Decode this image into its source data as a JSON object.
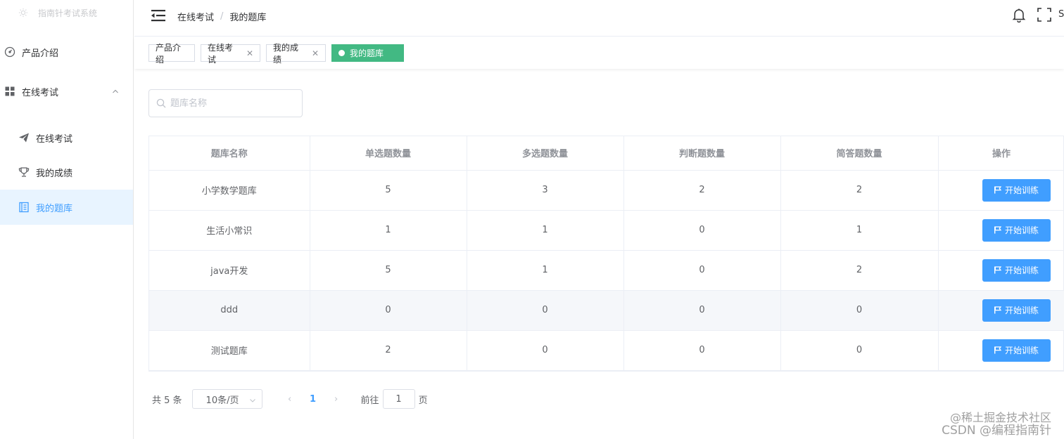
{
  "sidebar": {
    "logo_text": "指南针考试系统",
    "items": [
      {
        "label": "产品介绍",
        "icon": "speedometer-icon"
      },
      {
        "label": "在线考试",
        "icon": "grid-icon"
      }
    ],
    "submenu": [
      {
        "label": "在线考试",
        "icon": "send-icon"
      },
      {
        "label": "我的成绩",
        "icon": "trophy-icon"
      },
      {
        "label": "我的题库",
        "icon": "notebook-icon",
        "active": true
      }
    ]
  },
  "header": {
    "breadcrumb": [
      "在线考试",
      "我的题库"
    ],
    "user_initial": "S"
  },
  "tags": [
    {
      "label": "产品介绍",
      "closable": false
    },
    {
      "label": "在线考试",
      "closable": true
    },
    {
      "label": "我的成绩",
      "closable": true
    },
    {
      "label": "我的题库",
      "active": true
    }
  ],
  "search": {
    "placeholder": "题库名称",
    "value": ""
  },
  "table": {
    "columns": [
      "题库名称",
      "单选题数量",
      "多选题数量",
      "判断题数量",
      "简答题数量",
      "操作"
    ],
    "rows": [
      {
        "name": "小学数学题库",
        "single": "5",
        "multi": "3",
        "judge": "2",
        "short": "2"
      },
      {
        "name": "生活小常识",
        "single": "1",
        "multi": "1",
        "judge": "0",
        "short": "1"
      },
      {
        "name": "java开发",
        "single": "5",
        "multi": "1",
        "judge": "0",
        "short": "2"
      },
      {
        "name": "ddd",
        "single": "0",
        "multi": "0",
        "judge": "0",
        "short": "0"
      },
      {
        "name": "测试题库",
        "single": "2",
        "multi": "0",
        "judge": "0",
        "short": "0"
      }
    ],
    "action_label": "开始训练"
  },
  "pagination": {
    "total_text": "共 5 条",
    "page_size": "10条/页",
    "current_page": "1",
    "goto_label": "前往",
    "goto_value": "1",
    "page_suffix": "页"
  },
  "watermark": {
    "line1": "@稀土掘金技术社区",
    "line2": "CSDN @编程指南针"
  },
  "colors": {
    "primary": "#409eff",
    "tag_active": "#42b983",
    "menu_active_bg": "#e8f4ff"
  }
}
